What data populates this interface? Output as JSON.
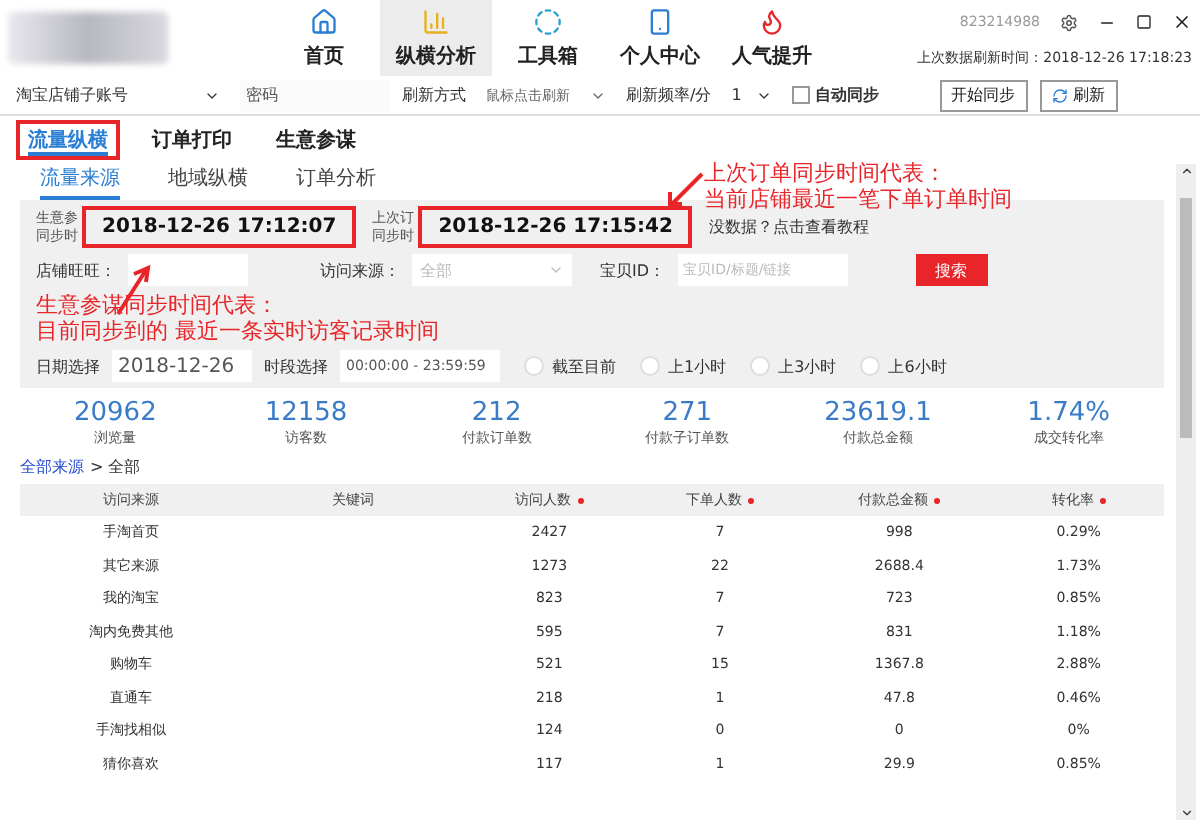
{
  "app": {
    "user_id": "823214988",
    "last_refresh": "上次数据刷新时间：2018-12-26 17:18:23"
  },
  "nav": [
    {
      "label": "首页",
      "selected": false
    },
    {
      "label": "纵横分析",
      "selected": true
    },
    {
      "label": "工具箱",
      "selected": false
    },
    {
      "label": "个人中心",
      "selected": false
    },
    {
      "label": "人气提升",
      "selected": false
    }
  ],
  "toolbar": {
    "account": "淘宝店铺子账号",
    "password_placeholder": "密码",
    "refresh_mode_label": "刷新方式",
    "refresh_mode": "鼠标点击刷新",
    "frequency_label": "刷新频率/分",
    "frequency": "1",
    "auto_sync": {
      "label": "自动同步",
      "checked": false
    },
    "start_button": "开始同步",
    "refresh_button": "刷新"
  },
  "tabs": [
    {
      "label": "流量纵横",
      "selected": true,
      "highlighted": true
    },
    {
      "label": "订单打印",
      "selected": false,
      "highlighted": false
    },
    {
      "label": "生意参谋",
      "selected": false,
      "highlighted": false
    }
  ],
  "subtabs": [
    {
      "label": "流量来源",
      "selected": true
    },
    {
      "label": "地域纵横",
      "selected": false
    },
    {
      "label": "订单分析",
      "selected": false
    }
  ],
  "sync": [
    {
      "label": [
        "生意参",
        "同步时"
      ],
      "value": "2018-12-26 17:12:07",
      "highlighted": true
    },
    {
      "label": [
        "上次订",
        "同步时"
      ],
      "value": "2018-12-26 17:15:42",
      "highlighted": true
    }
  ],
  "help_link": "没数据？点击查看教程",
  "filters": {
    "shop_label": "店铺旺旺：",
    "source_label": "访问来源：",
    "source_value": "全部",
    "item_label": "宝贝ID：",
    "item_placeholder": "宝贝ID/标题/链接",
    "search_button": "搜索",
    "date_label": "日期选择",
    "date_value": "2018-12-26",
    "time_label": "时段选择",
    "time_value": "00:00:00 - 23:59:59",
    "ranges": [
      {
        "label": "截至目前",
        "selected": false
      },
      {
        "label": "上1小时",
        "selected": false
      },
      {
        "label": "上3小时",
        "selected": false
      },
      {
        "label": "上6小时",
        "selected": false
      }
    ]
  },
  "stats": [
    {
      "value": "20962",
      "label": "浏览量"
    },
    {
      "value": "12158",
      "label": "访客数"
    },
    {
      "value": "212",
      "label": "付款订单数"
    },
    {
      "value": "271",
      "label": "付款子订单数"
    },
    {
      "value": "23619.1",
      "label": "付款总金额"
    },
    {
      "value": "1.74%",
      "label": "成交转化率"
    }
  ],
  "breadcrumb": {
    "link": "全部来源",
    "current": "> 全部"
  },
  "table": {
    "columns": [
      {
        "label": "访问来源",
        "sortable": false
      },
      {
        "label": "关键词",
        "sortable": false
      },
      {
        "label": "访问人数",
        "sortable": true
      },
      {
        "label": "下单人数",
        "sortable": true
      },
      {
        "label": "付款总金额",
        "sortable": true
      },
      {
        "label": "转化率",
        "sortable": true
      }
    ],
    "rows": [
      [
        "手淘首页",
        "",
        "2427",
        "7",
        "998",
        "0.29%"
      ],
      [
        "其它来源",
        "",
        "1273",
        "22",
        "2688.4",
        "1.73%"
      ],
      [
        "我的淘宝",
        "",
        "823",
        "7",
        "723",
        "0.85%"
      ],
      [
        "淘内免费其他",
        "",
        "595",
        "7",
        "831",
        "1.18%"
      ],
      [
        "购物车",
        "",
        "521",
        "15",
        "1367.8",
        "2.88%"
      ],
      [
        "直通车",
        "",
        "218",
        "1",
        "47.8",
        "0.46%"
      ],
      [
        "手淘找相似",
        "",
        "124",
        "0",
        "0",
        "0%"
      ],
      [
        "猜你喜欢",
        "",
        "117",
        "1",
        "29.9",
        "0.85%"
      ]
    ]
  },
  "annotations": [
    {
      "kind": "left",
      "lines": [
        "生意参谋同步时间代表：",
        "目前同步到的 最近一条实时访客记录时间"
      ]
    },
    {
      "kind": "right",
      "lines": [
        "上次订单同步时间代表：",
        "当前店铺最近一笔下单订单时间"
      ]
    }
  ]
}
